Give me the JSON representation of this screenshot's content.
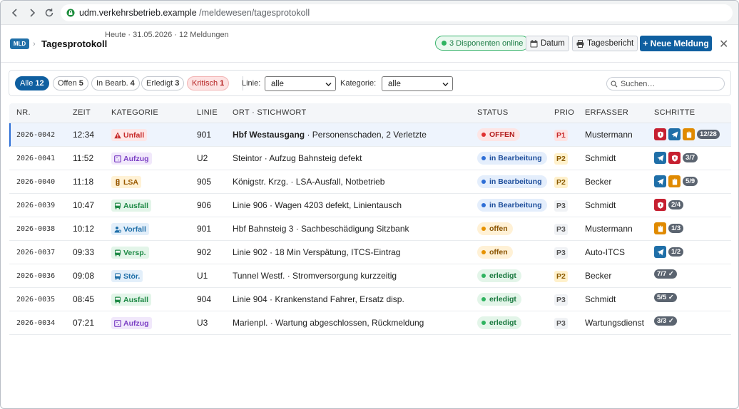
{
  "browser": {
    "url_host": "udm.verkehrsbetrieb.example",
    "url_path": "/meldewesen/tagesprotokoll"
  },
  "header": {
    "logo": "MLD",
    "breadcrumb_sep": "›",
    "title": "Tagesprotokoll",
    "meta": "Heute · 31.05.2026 · 12 Meldungen",
    "online": "3 Disponenten online",
    "datum_label": "Datum",
    "bericht_label": "Tagesbericht",
    "new_label": "+ Neue Meldung",
    "close": "✕"
  },
  "filter": {
    "pills": [
      {
        "label": "Alle",
        "count": "12"
      },
      {
        "label": "Offen",
        "count": "5"
      },
      {
        "label": "In Bearb.",
        "count": "4"
      },
      {
        "label": "Erledigt",
        "count": "3"
      },
      {
        "label": "Kritisch",
        "count": "1"
      }
    ],
    "linie_label": "Linie:",
    "linie_value": "alle",
    "kategorie_label": "Kategorie:",
    "kategorie_value": "alle",
    "search_placeholder": "Suchen…"
  },
  "columns": [
    "NR.",
    "ZEIT",
    "KATEGORIE",
    "LINIE",
    "ORT · STICHWORT",
    "STATUS",
    "PRIO",
    "ERFASSER",
    "SCHRITTE"
  ],
  "colors": {
    "primary": "#0f5fa0",
    "unfall": "#c62828",
    "aufzug": "#7b3fc4",
    "lsa": "#b26a00",
    "ausfall": "#1f8a46",
    "vorfall": "#1f6fa8",
    "stoer": "#1f6fa8",
    "offen_kritisch": "#c62828",
    "in_bearbeitung": "#1f5fbf",
    "offen": "#a86400",
    "erledigt": "#1f8a46"
  },
  "rows": [
    {
      "nr": "2026-0042",
      "zeit": "12:34",
      "kategorie": "Unfall",
      "cat_type": "unfall",
      "linie": "901",
      "ort": "Hbf Westausgang",
      "stichwort": "· Personenschaden, 2 Verletzte",
      "status": "OFFEN",
      "status_type": "kritisch",
      "prio": "P1",
      "erfasser": "Mustermann",
      "steps": [
        "shield",
        "send",
        "clip"
      ],
      "count": "12/28",
      "selected": true
    },
    {
      "nr": "2026-0041",
      "zeit": "11:52",
      "kategorie": "Aufzug",
      "cat_type": "aufzug",
      "linie": "U2",
      "ort": "",
      "stichwort": "Steintor · Aufzug Bahnsteig defekt",
      "status": "in Bearbeitung",
      "status_type": "bearb",
      "prio": "P2",
      "erfasser": "Schmidt",
      "steps": [
        "send",
        "shield"
      ],
      "count": "3/7"
    },
    {
      "nr": "2026-0040",
      "zeit": "11:18",
      "kategorie": "LSA",
      "cat_type": "lsa",
      "linie": "905",
      "ort": "",
      "stichwort": "Königstr. Krzg. · LSA-Ausfall, Notbetrieb",
      "status": "in Bearbeitung",
      "status_type": "bearb",
      "prio": "P2",
      "erfasser": "Becker",
      "steps": [
        "send",
        "clip"
      ],
      "count": "5/9"
    },
    {
      "nr": "2026-0039",
      "zeit": "10:47",
      "kategorie": "Ausfall",
      "cat_type": "ausfall",
      "linie": "906",
      "ort": "",
      "stichwort": "Linie 906 · Wagen 4203 defekt, Linientausch",
      "status": "in Bearbeitung",
      "status_type": "bearb",
      "prio": "P3",
      "erfasser": "Schmidt",
      "steps": [
        "shield"
      ],
      "count": "2/4"
    },
    {
      "nr": "2026-0038",
      "zeit": "10:12",
      "kategorie": "Vorfall",
      "cat_type": "vorfall",
      "linie": "901",
      "ort": "",
      "stichwort": "Hbf Bahnsteig 3 · Sachbeschädigung Sitzbank",
      "status": "offen",
      "status_type": "offen",
      "prio": "P3",
      "erfasser": "Mustermann",
      "steps": [
        "clip"
      ],
      "count": "1/3"
    },
    {
      "nr": "2026-0037",
      "zeit": "09:33",
      "kategorie": "Versp.",
      "cat_type": "ausfall",
      "linie": "902",
      "ort": "",
      "stichwort": "Linie 902 · 18 Min Verspätung, ITCS-Eintrag",
      "status": "offen",
      "status_type": "offen",
      "prio": "P3",
      "erfasser": "Auto-ITCS",
      "steps": [
        "send"
      ],
      "count": "1/2"
    },
    {
      "nr": "2026-0036",
      "zeit": "09:08",
      "kategorie": "Stör.",
      "cat_type": "stoer",
      "linie": "U1",
      "ort": "",
      "stichwort": "Tunnel Westf. · Stromversorgung kurzzeitig",
      "status": "erledigt",
      "status_type": "erledigt",
      "prio": "P2",
      "erfasser": "Becker",
      "steps": [],
      "count": "7/7 ✓"
    },
    {
      "nr": "2026-0035",
      "zeit": "08:45",
      "kategorie": "Ausfall",
      "cat_type": "ausfall",
      "linie": "904",
      "ort": "",
      "stichwort": "Linie 904 · Krankenstand Fahrer, Ersatz disp.",
      "status": "erledigt",
      "status_type": "erledigt",
      "prio": "P3",
      "erfasser": "Schmidt",
      "steps": [],
      "count": "5/5 ✓"
    },
    {
      "nr": "2026-0034",
      "zeit": "07:21",
      "kategorie": "Aufzug",
      "cat_type": "aufzug",
      "linie": "U3",
      "ort": "",
      "stichwort": "Marienpl. · Wartung abgeschlossen, Rückmeldung",
      "status": "erledigt",
      "status_type": "erledigt",
      "prio": "P3",
      "erfasser": "Wartungsdienst",
      "steps": [],
      "count": "3/3 ✓"
    }
  ]
}
